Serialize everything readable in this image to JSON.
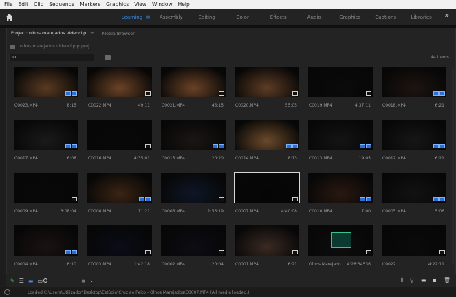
{
  "menu": [
    "File",
    "Edit",
    "Clip",
    "Sequence",
    "Markers",
    "Graphics",
    "View",
    "Window",
    "Help"
  ],
  "workspaces": {
    "tabs": [
      "Learning",
      "Assembly",
      "Editing",
      "Color",
      "Effects",
      "Audio",
      "Graphics",
      "Captions",
      "Libraries"
    ],
    "active": "Learning",
    "more": "»"
  },
  "panel": {
    "project_tab": "Project: olhos marejados videoclip",
    "media_browser_tab": "Media Browser",
    "path": "olhos marejados videoclip.prproj",
    "search_placeholder": "",
    "item_count": "44 items"
  },
  "clips": [
    {
      "name": "C0023.MP4",
      "duration": "8:15",
      "badge": "video+audio"
    },
    {
      "name": "C0022.MP4",
      "duration": "49:11",
      "badge": "video"
    },
    {
      "name": "C0021.MP4",
      "duration": "45:15",
      "badge": "video"
    },
    {
      "name": "C0020.MP4",
      "duration": "55:05",
      "badge": "video"
    },
    {
      "name": "C0019.MP4",
      "duration": "4:37:11",
      "badge": "video"
    },
    {
      "name": "C0018.MP4",
      "duration": "6:21",
      "badge": "video+audio"
    },
    {
      "name": "C0017.MP4",
      "duration": "6:08",
      "badge": "video+audio"
    },
    {
      "name": "C0016.MP4",
      "duration": "4:35:01",
      "badge": "video"
    },
    {
      "name": "C0015.MP4",
      "duration": "20:20",
      "badge": "video+audio"
    },
    {
      "name": "C0014.MP4",
      "duration": "8:13",
      "badge": "video+audio"
    },
    {
      "name": "C0013.MP4",
      "duration": "19:05",
      "badge": "video+audio"
    },
    {
      "name": "C0012.MP4",
      "duration": "6:21",
      "badge": "video+audio"
    },
    {
      "name": "C0009.MP4",
      "duration": "3:08:04",
      "badge": "video"
    },
    {
      "name": "C0008.MP4",
      "duration": "11:21",
      "badge": "video+audio"
    },
    {
      "name": "C0006.MP4",
      "duration": "1:53:19",
      "badge": "video"
    },
    {
      "name": "C0007.MP4",
      "duration": "4:40:08",
      "badge": "video"
    },
    {
      "name": "C0010.MP4",
      "duration": "7:00",
      "badge": "video+audio"
    },
    {
      "name": "C0005.MP4",
      "duration": "5:06",
      "badge": "video+audio"
    },
    {
      "name": "C0004.MP4",
      "duration": "6:10",
      "badge": "video+audio"
    },
    {
      "name": "C0003.MP4",
      "duration": "1:42:18",
      "badge": "video"
    },
    {
      "name": "C0002.MP4",
      "duration": "20:04",
      "badge": "video"
    },
    {
      "name": "C0001.MP4",
      "duration": "6:21",
      "badge": "video"
    },
    {
      "name": "Olhos Marejado",
      "duration": "4:28:34536",
      "badge": "video"
    },
    {
      "name": "C0022",
      "duration": "4:22:11",
      "badge": "video"
    }
  ],
  "statusbar": {
    "message": "Loaded C:\\Users\\Utilizador\\Desktop\\Estúdio\\Cruz ao Peito - Olhos Marejados\\C0007.MP4 (All media loaded.)"
  },
  "colors": {
    "accent": "#3b8fe8",
    "panel_bg": "#232323",
    "audio_clip": "#3bbf8f"
  }
}
